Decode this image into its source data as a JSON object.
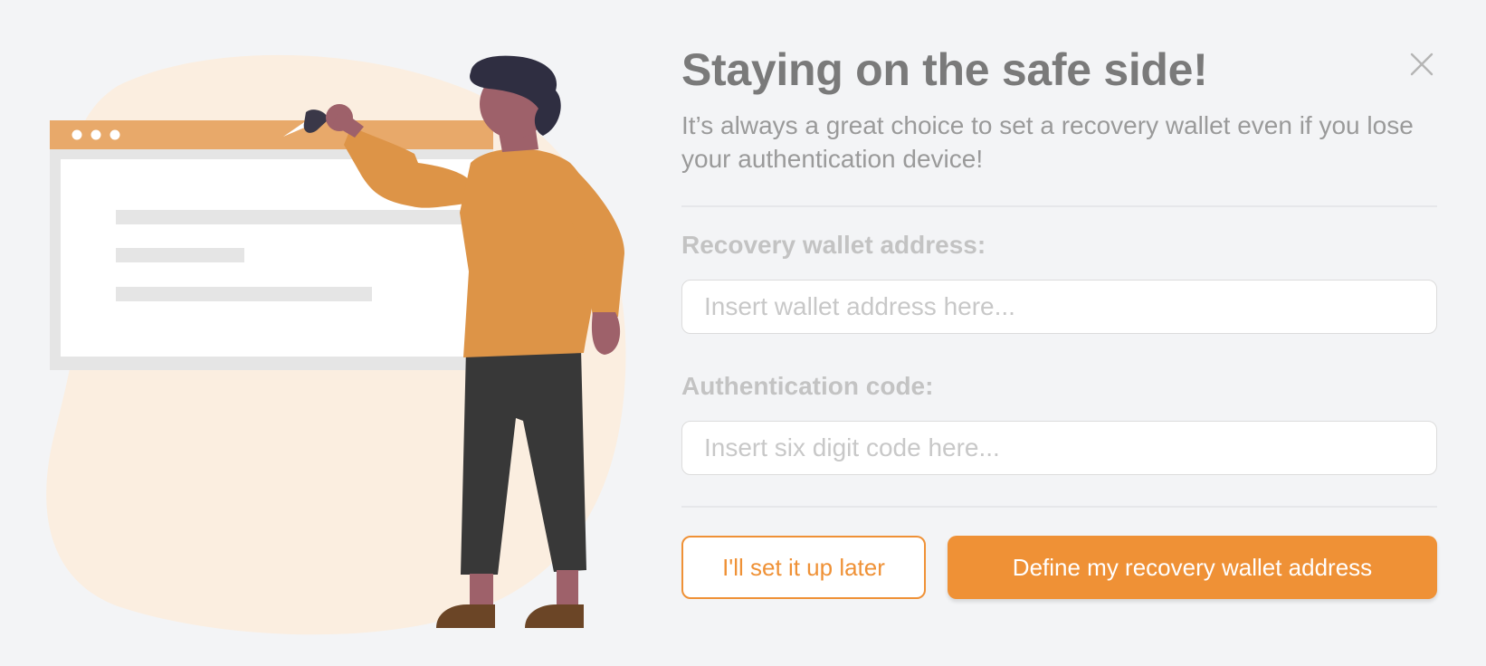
{
  "dialog": {
    "title": "Staying on the safe side!",
    "subtitle": "It’s always a great choice to set a recovery wallet even if you lose your authentication device!",
    "close_icon": "close-icon"
  },
  "form": {
    "wallet_label": "Recovery wallet address:",
    "wallet_placeholder": "Insert wallet address here...",
    "wallet_value": "",
    "code_label": "Authentication code:",
    "code_placeholder": "Insert six digit code here...",
    "code_value": ""
  },
  "actions": {
    "later_label": "I'll set it up later",
    "define_label": "Define my recovery wallet address"
  },
  "illustration": {
    "name": "person-pinning-browser-window-illustration"
  },
  "colors": {
    "accent": "#ef9136",
    "background": "#f3f4f6",
    "blob": "#fbeee0",
    "browser_bar": "#e8a96a",
    "shirt": "#dd9447",
    "pants": "#383838",
    "hair": "#2f2e41",
    "skin": "#9e616a",
    "shoes": "#6b4526"
  }
}
